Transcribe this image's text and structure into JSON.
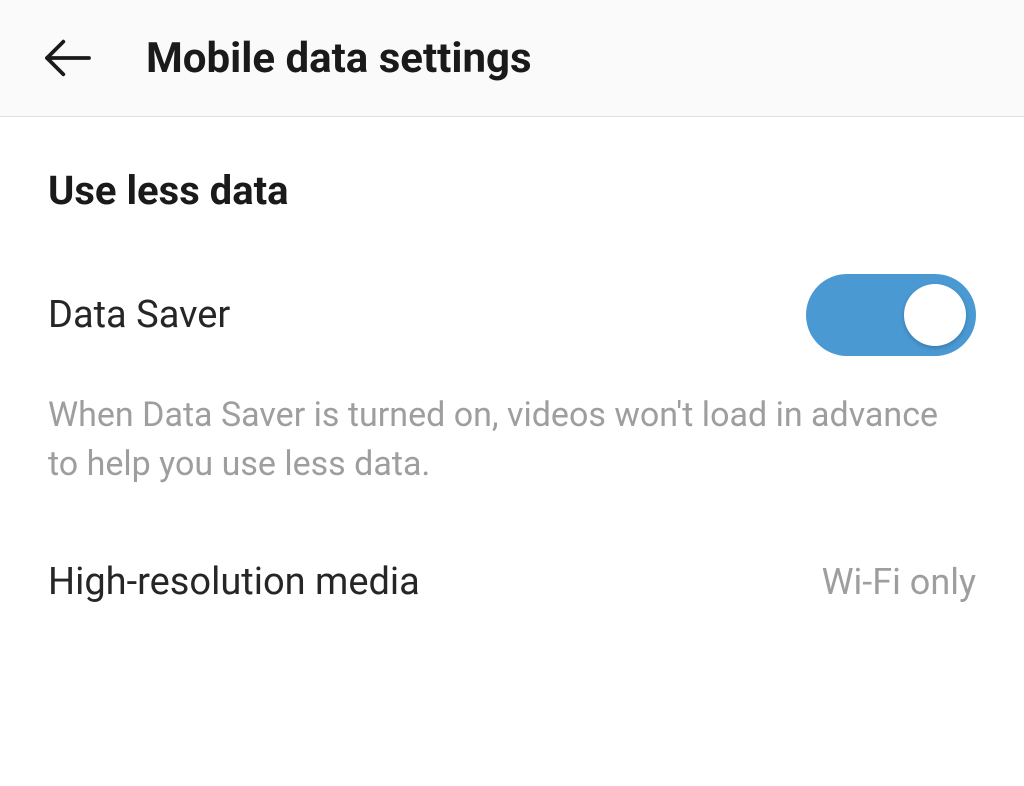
{
  "header": {
    "title": "Mobile data settings"
  },
  "section": {
    "heading": "Use less data"
  },
  "dataSaver": {
    "label": "Data Saver",
    "description": "When Data Saver is turned on, videos won't load in advance to help you use less data.",
    "enabled": true
  },
  "highResMedia": {
    "label": "High-resolution media",
    "value": "Wi-Fi only"
  },
  "colors": {
    "toggleOn": "#4a99d3",
    "textPrimary": "#262626",
    "textSecondary": "#9e9e9e",
    "headerBg": "#fafafa"
  }
}
